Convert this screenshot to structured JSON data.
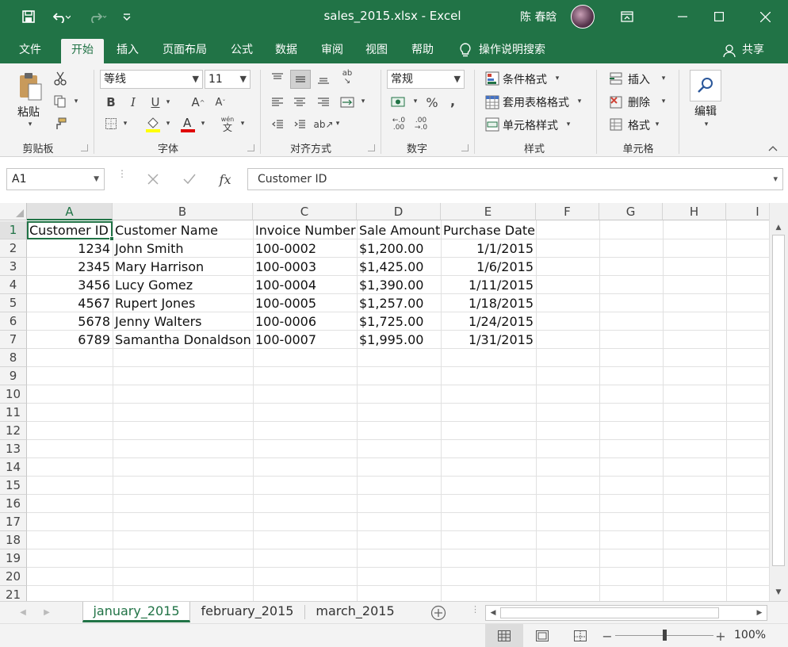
{
  "window": {
    "title": "sales_2015.xlsx  -  Excel",
    "user": "陈 春晗"
  },
  "ribbon_tabs": [
    {
      "label": "文件"
    },
    {
      "label": "开始"
    },
    {
      "label": "插入"
    },
    {
      "label": "页面布局"
    },
    {
      "label": "公式"
    },
    {
      "label": "数据"
    },
    {
      "label": "审阅"
    },
    {
      "label": "视图"
    },
    {
      "label": "帮助"
    }
  ],
  "tell_me": "操作说明搜索",
  "share": "共享",
  "ribbon": {
    "clipboard": {
      "paste": "粘贴",
      "group": "剪贴板"
    },
    "font": {
      "name": "等线",
      "size": "11",
      "group": "字体"
    },
    "alignment": {
      "group": "对齐方式"
    },
    "number": {
      "format": "常规",
      "group": "数字"
    },
    "styles": {
      "conditional": "条件格式",
      "table": "套用表格格式",
      "cell_styles": "单元格样式",
      "group": "样式"
    },
    "cells": {
      "insert": "插入",
      "delete": "删除",
      "format": "格式",
      "group": "单元格"
    },
    "editing": {
      "label": "编辑"
    }
  },
  "formula_bar": {
    "name_box": "A1",
    "fx": "fx",
    "content": "Customer ID"
  },
  "columns": [
    "A",
    "B",
    "C",
    "D",
    "E",
    "F",
    "G",
    "H",
    "I"
  ],
  "rows": [
    "1",
    "2",
    "3",
    "4",
    "5",
    "6",
    "7",
    "8",
    "9",
    "10",
    "11",
    "12",
    "13",
    "14",
    "15",
    "16",
    "17",
    "18",
    "19",
    "20",
    "21"
  ],
  "sheet": {
    "headers": [
      "Customer ID",
      "Customer Name",
      "Invoice Number",
      "Sale Amount",
      "Purchase Date"
    ],
    "data": [
      [
        "1234",
        "John Smith",
        "100-0002",
        "$1,200.00",
        "1/1/2015"
      ],
      [
        "2345",
        "Mary Harrison",
        "100-0003",
        "$1,425.00",
        "1/6/2015"
      ],
      [
        "3456",
        "Lucy Gomez",
        "100-0004",
        "$1,390.00",
        "1/11/2015"
      ],
      [
        "4567",
        "Rupert Jones",
        "100-0005",
        "$1,257.00",
        "1/18/2015"
      ],
      [
        "5678",
        "Jenny Walters",
        "100-0006",
        "$1,725.00",
        "1/24/2015"
      ],
      [
        "6789",
        "Samantha Donaldson",
        "100-0007",
        "$1,995.00",
        "1/31/2015"
      ]
    ]
  },
  "sheet_tabs": [
    {
      "label": "january_2015"
    },
    {
      "label": "february_2015"
    },
    {
      "label": "march_2015"
    }
  ],
  "status": {
    "zoom": "100%"
  },
  "colors": {
    "accent": "#217346"
  }
}
